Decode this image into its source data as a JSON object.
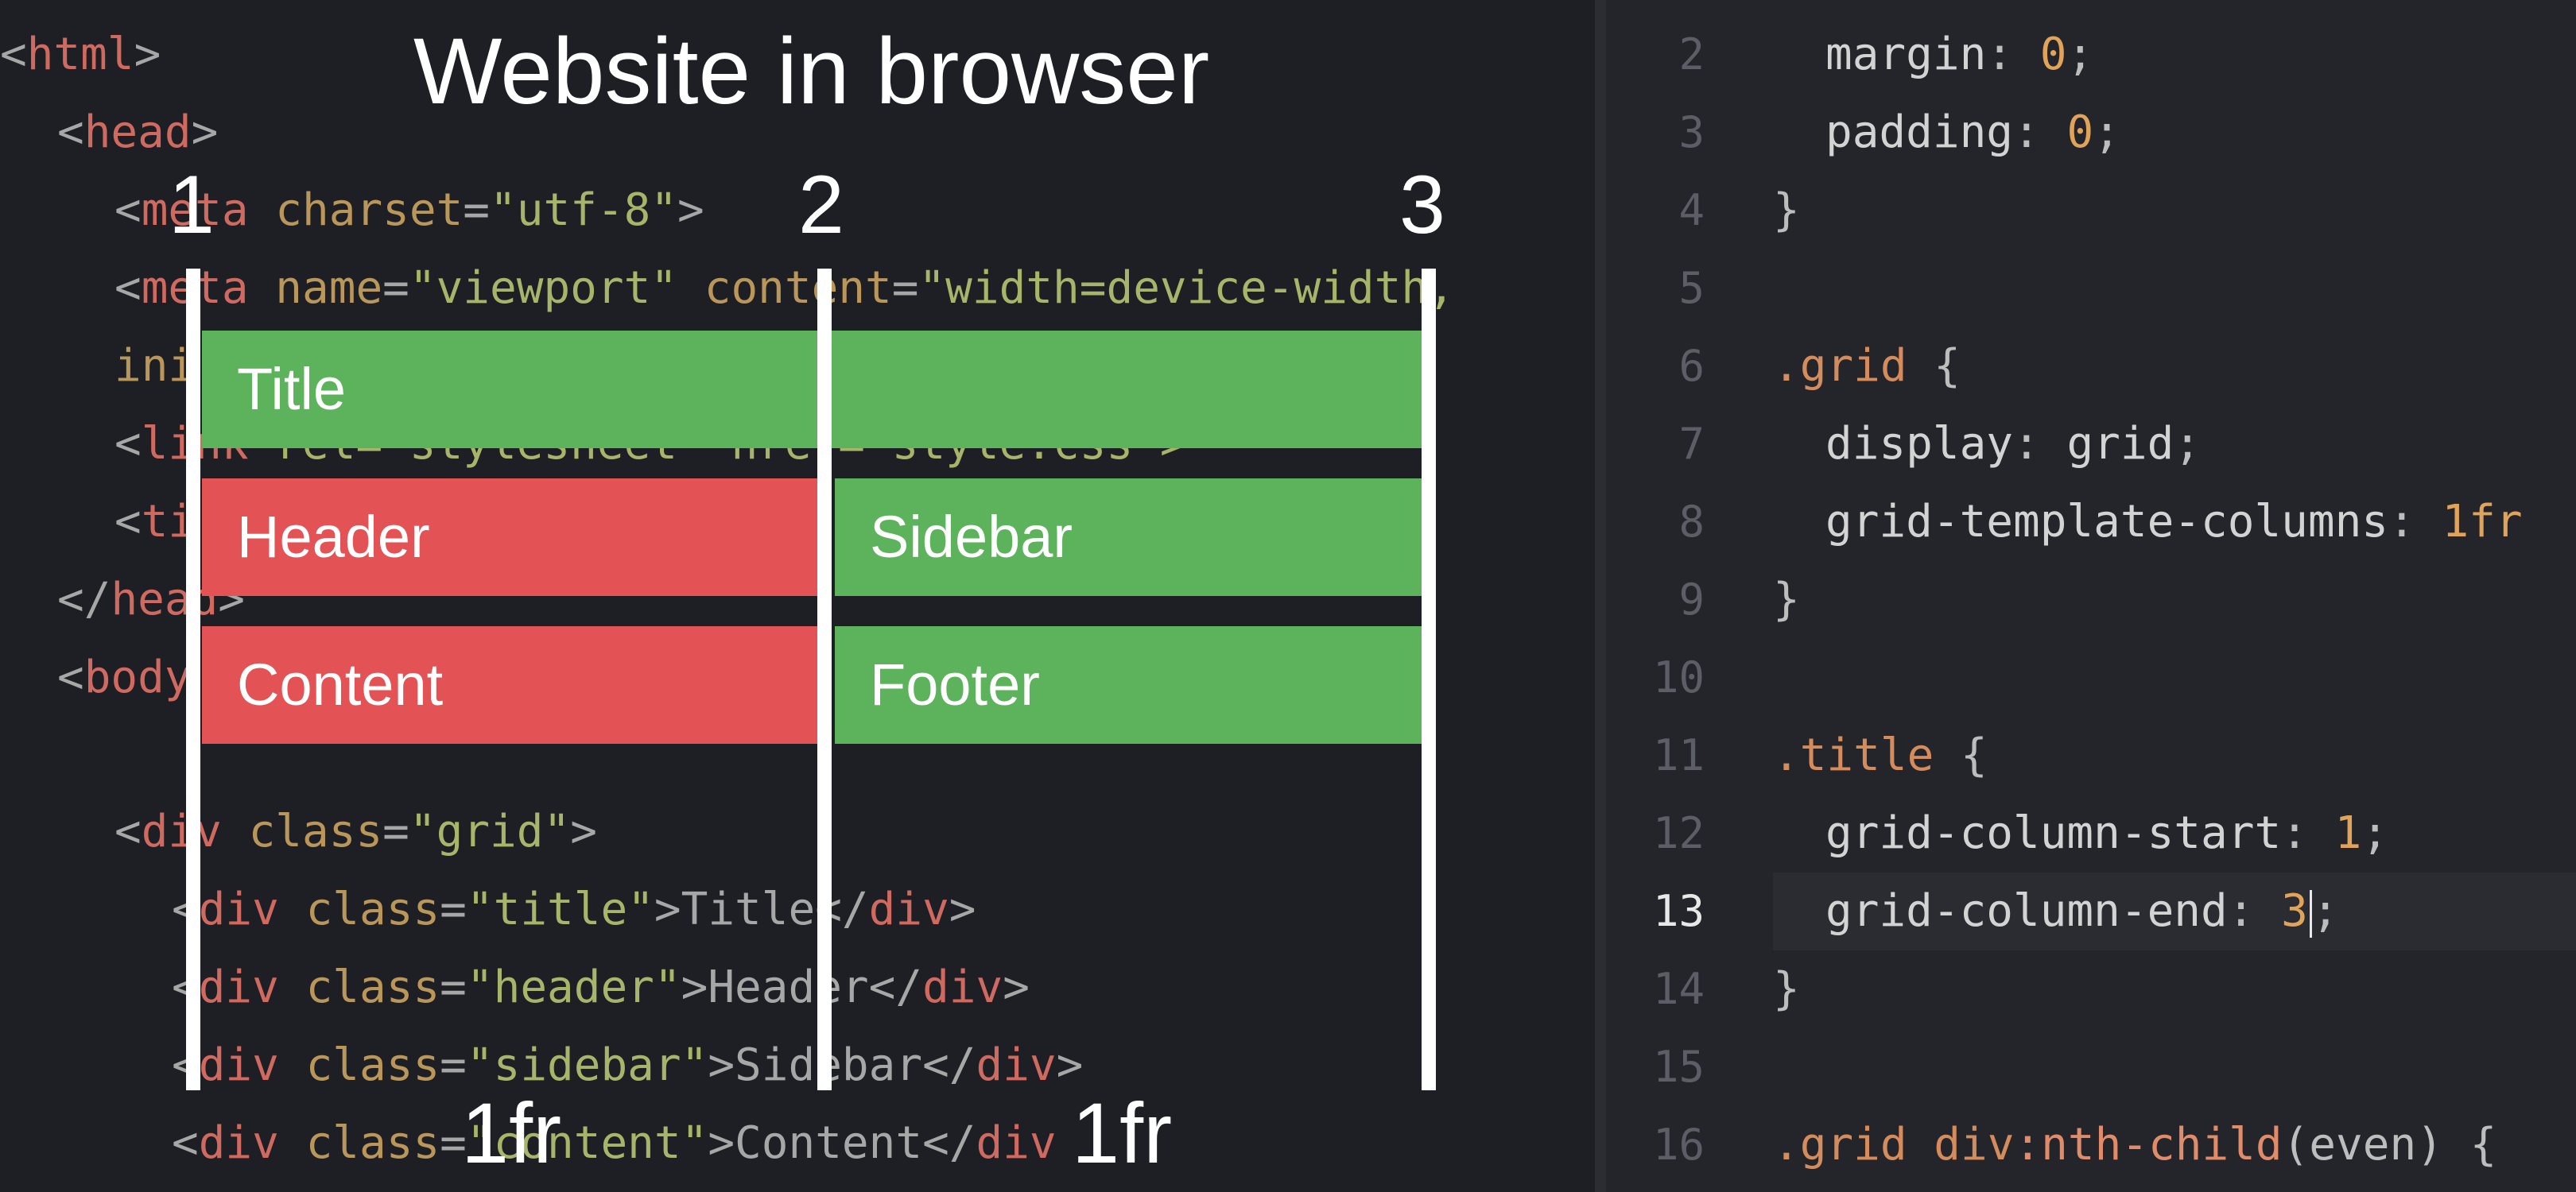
{
  "colors": {
    "background": "#1e1f24",
    "green_block": "#5db35b",
    "red_block": "#e35355",
    "overlay_text": "#ffffff",
    "number_literal": "#e0a35a"
  },
  "overlay": {
    "title": "Website in browser",
    "line_numbers": [
      "1",
      "2",
      "3"
    ],
    "fr_labels": [
      "1fr",
      "1fr"
    ],
    "blocks": {
      "title": "Title",
      "header": "Header",
      "sidebar": "Sidebar",
      "content": "Content",
      "footer": "Footer"
    }
  },
  "html_code": {
    "l1": {
      "open": "<",
      "tag": "html",
      "close": ">"
    },
    "l2": {
      "open": "<",
      "tag": "head",
      "close": ">"
    },
    "l3": {
      "open": "<",
      "tag": "meta",
      "attr": " charset",
      "eq": "=",
      "val": "\"utf-8\"",
      "close": ">"
    },
    "l4": {
      "open": "<",
      "tag": "meta",
      "attr1": " name",
      "eq1": "=",
      "val1": "\"viewport\"",
      "attr2": " content",
      "eq2": "=",
      "val2": "\"width=device-width,"
    },
    "l5": {
      "text": "ini"
    },
    "l6": {
      "open": "<",
      "tag": "link",
      "attr": " rel=\"stylesheet\" href=\"style.css\">"
    },
    "l7": {
      "open": "<",
      "tag": "ti"
    },
    "l8": {
      "open": "</",
      "tag": "head",
      "close": ">"
    },
    "l9": {
      "open": "<",
      "tag": "body"
    },
    "l11": {
      "open": "<",
      "tag": "div",
      "attr": " class",
      "eq": "=",
      "val": "\"grid\"",
      "close": ">"
    },
    "l12": {
      "open": "<",
      "tag": "div",
      "attr": " class",
      "eq": "=",
      "val": "\"title\"",
      "close": ">",
      "text": "Title",
      "endopen": "</",
      "endtag": "div",
      "endclose": ">"
    },
    "l13": {
      "open": "<",
      "tag": "div",
      "attr": " class",
      "eq": "=",
      "val": "\"header\"",
      "close": ">",
      "text": "Header",
      "endopen": "</",
      "endtag": "div",
      "endclose": ">"
    },
    "l14": {
      "open": "<",
      "tag": "div",
      "attr": " class",
      "eq": "=",
      "val": "\"sidebar\"",
      "close": ">",
      "text": "Sidebar",
      "endopen": "</",
      "endtag": "div",
      "endclose": ">"
    },
    "l15": {
      "open": "<",
      "tag": "div",
      "attr": " class",
      "eq": "=",
      "val": "\"content\"",
      "close": ">",
      "text": "Content",
      "endopen": "</",
      "endtag": "div"
    }
  },
  "css_code": {
    "gutter": [
      "2",
      "3",
      "4",
      "5",
      "6",
      "7",
      "8",
      "9",
      "10",
      "11",
      "12",
      "13",
      "14",
      "15",
      "16"
    ],
    "r2": {
      "prop": "margin",
      "colon": ": ",
      "val": "0",
      "semi": ";"
    },
    "r3": {
      "prop": "padding",
      "colon": ": ",
      "val": "0",
      "semi": ";"
    },
    "r4": {
      "text": "}"
    },
    "r6": {
      "sel": ".grid",
      "brace": " {"
    },
    "r7": {
      "prop": "display",
      "colon": ": ",
      "val": "grid",
      "semi": ";"
    },
    "r8": {
      "prop": "grid-template-columns",
      "colon": ": ",
      "val": "1fr"
    },
    "r9": {
      "text": "}"
    },
    "r11": {
      "sel": ".title",
      "brace": " {"
    },
    "r12": {
      "prop": "grid-column-start",
      "colon": ": ",
      "val": "1",
      "semi": ";"
    },
    "r13": {
      "prop": "grid-column-end",
      "colon": ": ",
      "val": "3",
      "semi": ";"
    },
    "r14": {
      "text": "}"
    },
    "r16": {
      "sel": ".grid div",
      "fn": ":nth-child",
      "arg": "(even)",
      "brace": " {"
    }
  }
}
